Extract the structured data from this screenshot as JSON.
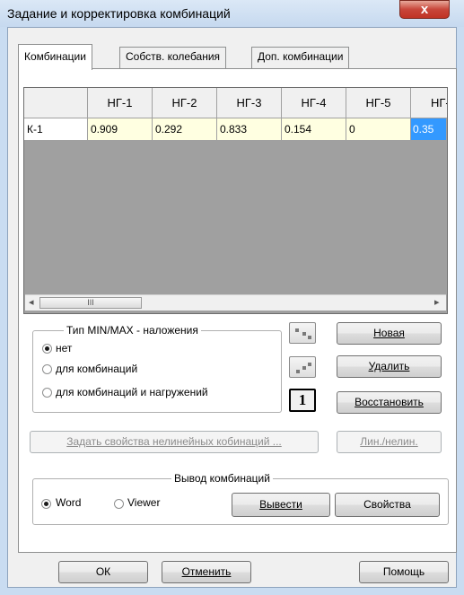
{
  "window": {
    "title": "Задание и корректировка комбинаций",
    "close": "x"
  },
  "tabs": [
    "Комбинации",
    "Собств. колебания",
    "Доп. комбинации"
  ],
  "grid": {
    "columns": [
      "НГ-1",
      "НГ-2",
      "НГ-3",
      "НГ-4",
      "НГ-5",
      "НГ-"
    ],
    "row": {
      "name": "К-1",
      "values": [
        "0.909",
        "0.292",
        "0.833",
        "0.154",
        "0",
        "0.35"
      ]
    },
    "scroll_left": "◂",
    "scroll_right": "▸",
    "thumb_grip": "III"
  },
  "overlay": {
    "legend": "Тип  MIN/MAX - наложения",
    "options": [
      "нет",
      "для комбинаций",
      "для комбинаций и нагружений"
    ],
    "selected": 0
  },
  "buttons": {
    "new": "Новая",
    "delete": "Удалить",
    "restore": "Восстановить",
    "icon_one": "1",
    "set_props": "Задать свойства нелинейных кобинаций ...",
    "lin_nonlin": "Лин./нелин."
  },
  "output": {
    "legend": "Вывод  комбинаций",
    "options": [
      "Word",
      "Viewer"
    ],
    "selected": 0,
    "export": "Вывести",
    "properties": "Свойства"
  },
  "footer": {
    "ok": "ОК",
    "cancel": "Отменить",
    "help": "Помощь"
  }
}
